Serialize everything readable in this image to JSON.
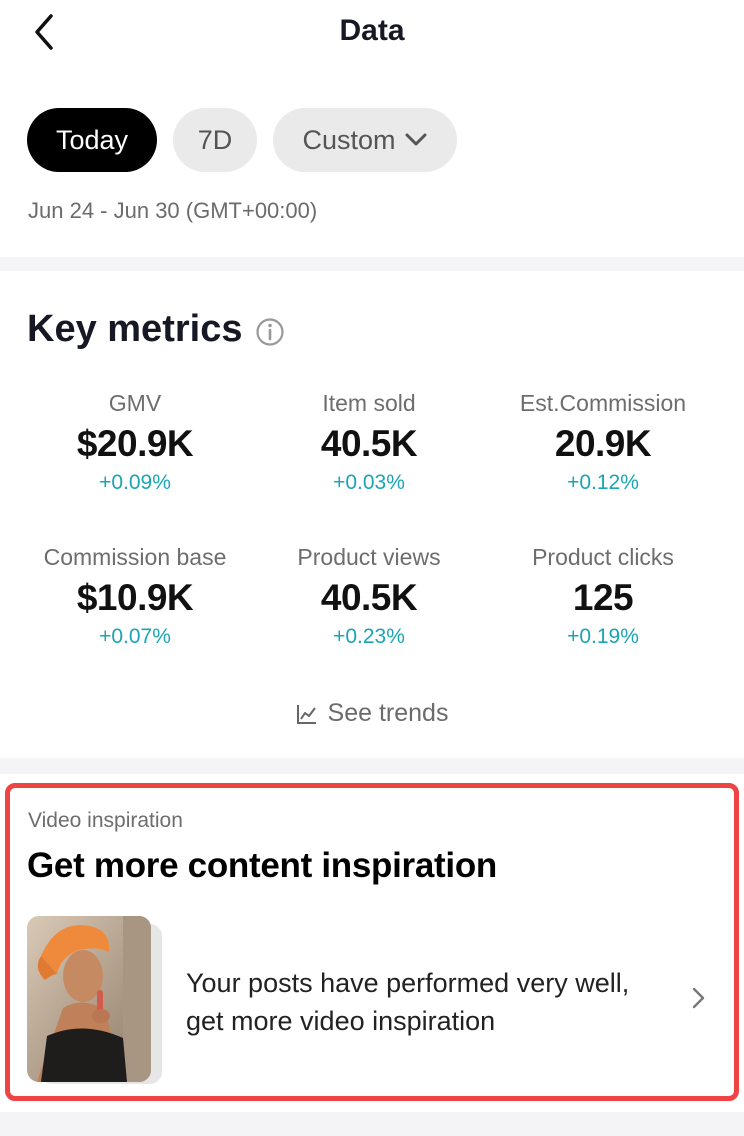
{
  "header": {
    "title": "Data"
  },
  "filters": {
    "chips": [
      {
        "label": "Today",
        "active": true
      },
      {
        "label": "7D",
        "active": false
      },
      {
        "label": "Custom",
        "active": false
      }
    ],
    "date_range": "Jun 24 - Jun 30 (GMT+00:00)"
  },
  "key_metrics": {
    "title": "Key metrics",
    "items": [
      {
        "label": "GMV",
        "value": "$20.9K",
        "change": "+0.09%"
      },
      {
        "label": "Item sold",
        "value": "40.5K",
        "change": "+0.03%"
      },
      {
        "label": "Est.Commission",
        "value": "20.9K",
        "change": "+0.12%"
      },
      {
        "label": "Commission base",
        "value": "$10.9K",
        "change": "+0.07%"
      },
      {
        "label": "Product views",
        "value": "40.5K",
        "change": "+0.23%"
      },
      {
        "label": "Product clicks",
        "value": "125",
        "change": "+0.19%"
      }
    ],
    "see_trends": "See trends"
  },
  "video_inspiration": {
    "kicker": "Video inspiration",
    "title": "Get more content inspiration",
    "description": "Your posts have performed very well, get more video inspiration"
  },
  "colors": {
    "accent_change": "#1aa5b5",
    "highlight_border": "#ee4444",
    "chip_active": "#000000"
  },
  "icons": [
    "back-arrow-icon",
    "chevron-down-icon",
    "info-icon",
    "trend-chart-icon",
    "chevron-right-icon"
  ]
}
